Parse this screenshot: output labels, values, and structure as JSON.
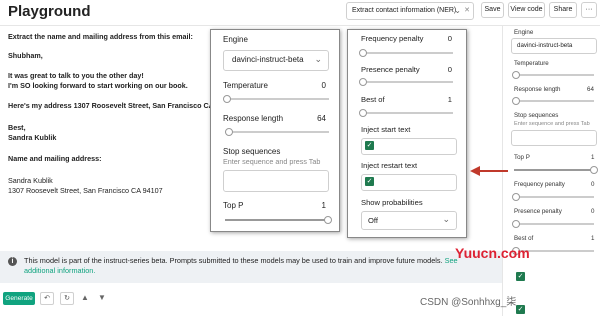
{
  "header": {
    "title": "Playground",
    "preset_value": "Extract contact information (NER)",
    "save_label": "Save",
    "view_code_label": "View code",
    "share_label": "Share",
    "more_label": "···"
  },
  "editor": {
    "lines": [
      "Extract the name and mailing address from this email:",
      "Shubham,",
      "It was great to talk to you the other day!",
      "I'm SO looking forward to start working on our book.",
      "Here's my address 1307 Roosevelt Street, San Francisco CA 94107",
      "Best,",
      "Sandra Kublik",
      "Name and mailing address:",
      "Sandra Kublik",
      "1307 Roosevelt Street, San Francisco CA 94107"
    ]
  },
  "notice": {
    "text": "This model is part of the instruct-series beta. Prompts submitted to these models may be used to train and improve future models.",
    "link": "See additional information."
  },
  "bottombar": {
    "generate_label": "Generate",
    "undo_icon": "undo-icon",
    "regenerate_icon": "refresh-icon",
    "thumbs_up_icon": "thumbs-up-icon",
    "thumbs_down_icon": "thumbs-down-icon"
  },
  "sidebar": {
    "engine_label": "Engine",
    "engine_value": "davinci-instruct-beta",
    "temperature_label": "Temperature",
    "response_length_label": "Response length",
    "response_length_value": "64",
    "stop_sequences_label": "Stop sequences",
    "stop_sequences_hint": "Enter sequence and press Tab",
    "top_p_label": "Top P",
    "top_p_value": "1",
    "frequency_penalty_label": "Frequency penalty",
    "frequency_penalty_value": "0",
    "presence_penalty_label": "Presence penalty",
    "presence_penalty_value": "0",
    "best_of_label": "Best of",
    "best_of_value": "1"
  },
  "panel_left": {
    "engine_label": "Engine",
    "engine_value": "davinci-instruct-beta",
    "temperature_label": "Temperature",
    "temperature_value": "0",
    "temperature_level": 0,
    "response_length_label": "Response length",
    "response_length_value": "64",
    "response_length_level": 0.03,
    "stop_sequences_label": "Stop sequences",
    "stop_sequences_hint": "Enter sequence and press Tab",
    "top_p_label": "Top P",
    "top_p_value": "1",
    "top_p_level": 1
  },
  "panel_right": {
    "frequency_penalty_label": "Frequency penalty",
    "frequency_penalty_value": "0",
    "presence_penalty_label": "Presence penalty",
    "presence_penalty_value": "0",
    "best_of_label": "Best of",
    "best_of_value": "1",
    "inject_start_label": "Inject start text",
    "inject_restart_label": "Inject restart text",
    "show_probabilities_label": "Show probabilities",
    "show_probabilities_value": "Off"
  },
  "watermarks": {
    "site": "Yuucn.com",
    "csdn": "CSDN @Sonhhxg_柒"
  },
  "colors": {
    "accent": "#10a37f",
    "arrow": "#c0392b",
    "checkbox": "#1f7a4f"
  }
}
